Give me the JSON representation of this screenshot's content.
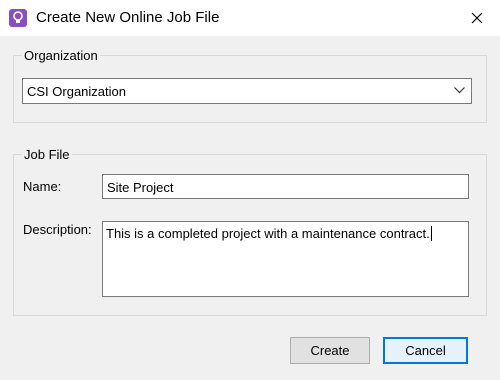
{
  "window": {
    "title": "Create New Online Job File",
    "icon": "bulb-icon",
    "close_icon": "close-icon"
  },
  "organization": {
    "group_label": "Organization",
    "selected": "CSI Organization"
  },
  "job_file": {
    "group_label": "Job File",
    "name_label": "Name:",
    "name_value": "Site Project",
    "description_label": "Description:",
    "description_value": "This is a completed project with a maintenance contract."
  },
  "buttons": {
    "create": "Create",
    "cancel": "Cancel"
  },
  "colors": {
    "accent": "#0078d7",
    "app_icon": "#8a4fbf"
  }
}
